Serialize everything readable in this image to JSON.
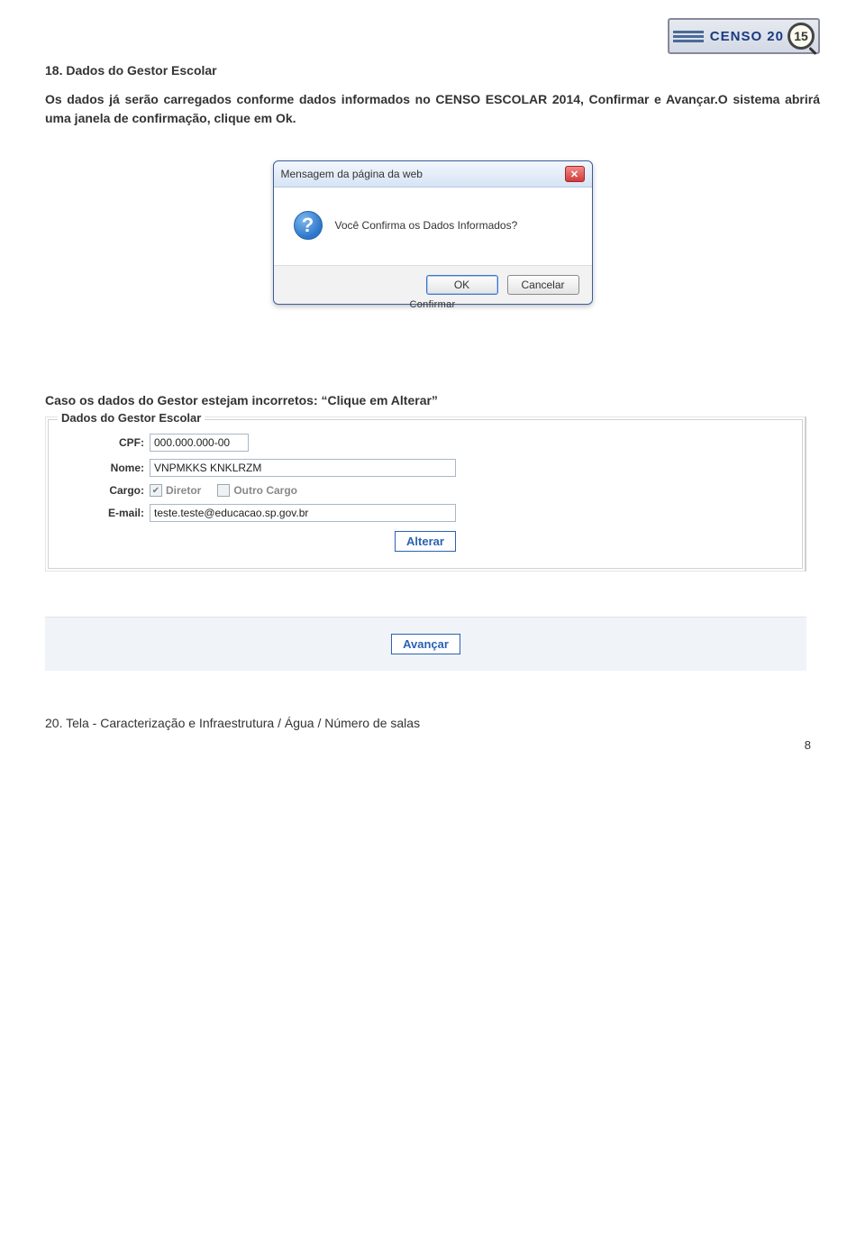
{
  "logo": {
    "brand": "CENSO 20",
    "year_highlight": "15"
  },
  "heading": "18. Dados do Gestor Escolar",
  "intro": "Os dados já serão carregados conforme dados informados no CENSO ESCOLAR 2014, Confirmar e Avançar.O sistema abrirá uma janela de confirmação, clique em Ok.",
  "dialog": {
    "title": "Mensagem da página da web",
    "message": "Você Confirma os Dados Informados?",
    "ok": "OK",
    "cancel": "Cancelar",
    "close_glyph": "✕",
    "q_glyph": "?",
    "cropped_below": "Confirmar"
  },
  "section_alt": "Caso os dados do Gestor estejam  incorretos: “Clique em Alterar”",
  "form": {
    "legend": "Dados do Gestor Escolar",
    "cpf_label": "CPF:",
    "cpf_value": "000.000.000-00",
    "nome_label": "Nome:",
    "nome_value": "VNPMKKS KNKLRZM",
    "cargo_label": "Cargo:",
    "cargo_diretor": "Diretor",
    "cargo_outro": "Outro Cargo",
    "email_label": "E-mail:",
    "email_value": "teste.teste@educacao.sp.gov.br",
    "alterar": "Alterar",
    "avancar": "Avançar",
    "checkmark": "✔"
  },
  "tela_line": "20. Tela - Caracterização e Infraestrutura / Água / Número de salas",
  "page_number": "8"
}
